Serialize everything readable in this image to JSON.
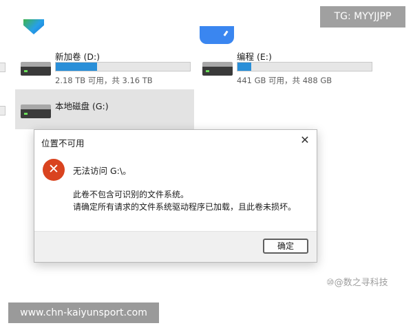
{
  "badges": {
    "telegram": "TG: MYYJJPP",
    "website": "www.chn-kaiyunsport.com",
    "watermark": "⑩@数之寻科技"
  },
  "drives": [
    {
      "label": "新加卷 (D:)",
      "size_text": "2.18 TB 可用，共 3.16 TB",
      "used_fraction": 0.31
    },
    {
      "label": "编程 (E:)",
      "size_text": "441 GB 可用，共 488 GB",
      "used_fraction": 0.1
    },
    {
      "label": "本地磁盘 (G:)"
    }
  ],
  "dialog": {
    "title": "位置不可用",
    "close_symbol": "✕",
    "error_symbol": "✕",
    "main_message": "无法访问 G:\\。",
    "detail_line_1": "此卷不包含可识别的文件系统。",
    "detail_line_2": "请确定所有请求的文件系统驱动程序已加载，且此卷未损坏。",
    "ok_label": "确定"
  },
  "colors": {
    "usage_bar": "#2a8fd8",
    "error_icon": "#d9431f"
  }
}
